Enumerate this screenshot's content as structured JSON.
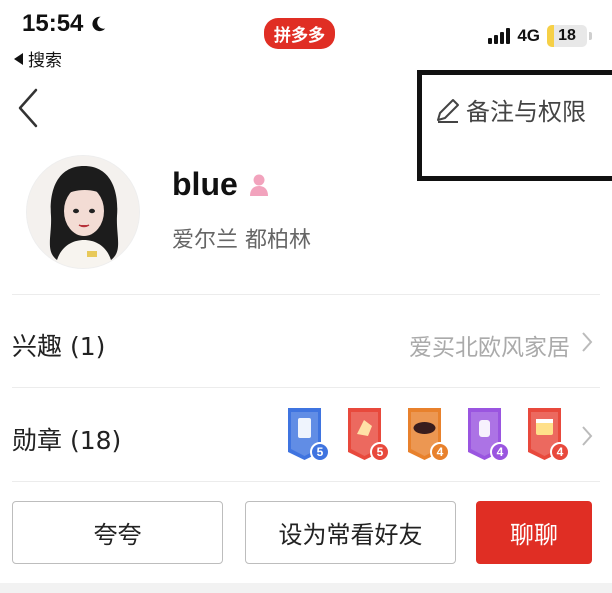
{
  "status_bar": {
    "time": "15:54",
    "back_app": "搜索",
    "app_badge": "拼多多",
    "network": "4G",
    "battery": "18",
    "battery_level": 0.18
  },
  "header": {
    "edit_label": "备注与权限"
  },
  "profile": {
    "name": "blue",
    "location": "爱尔兰 都柏林"
  },
  "interests": {
    "label": "兴趣 (1)",
    "value": "爱买北欧风家居"
  },
  "medals": {
    "label": "勋章 (18)",
    "badges": [
      {
        "name": "phone-medal",
        "level": "5",
        "color": "#3f74e0"
      },
      {
        "name": "hand-medal",
        "level": "5",
        "color": "#e8493c"
      },
      {
        "name": "mask-medal",
        "level": "4",
        "color": "#e8812c"
      },
      {
        "name": "bottle-medal",
        "level": "4",
        "color": "#9a55e0"
      },
      {
        "name": "calendar-medal",
        "level": "4",
        "color": "#e8493c"
      }
    ]
  },
  "actions": {
    "praise": "夸夸",
    "set_friend": "设为常看好友",
    "chat": "聊聊"
  },
  "colors": {
    "brand_red": "#e02e24",
    "gender_female": "#f2a3bd"
  }
}
